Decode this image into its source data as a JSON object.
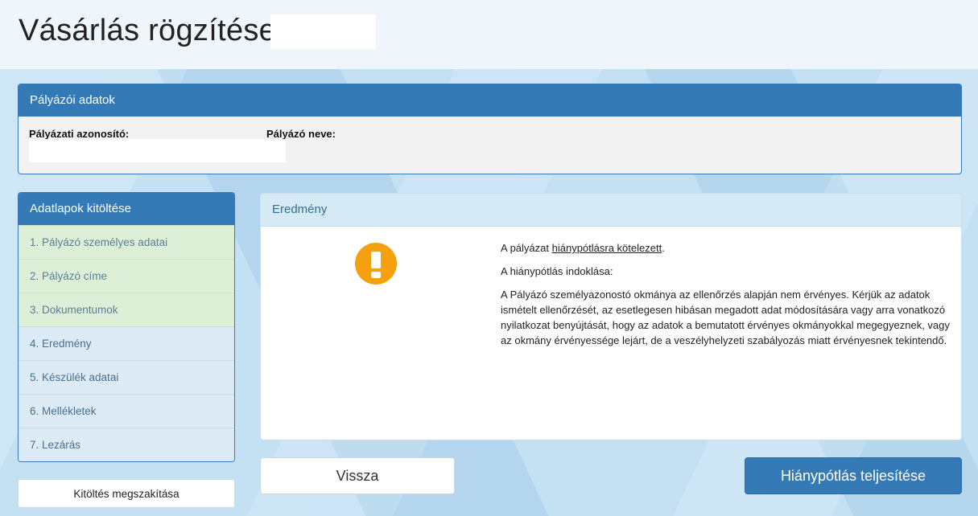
{
  "page": {
    "title": "Vásárlás rögzítése"
  },
  "applicant_panel": {
    "heading": "Pályázói adatok",
    "id_label": "Pályázati azonosító:",
    "name_label": "Pályázó neve:"
  },
  "sidebar": {
    "heading": "Adatlapok kitöltése",
    "steps": [
      {
        "label": "1. Pályázó személyes adatai",
        "status": "done"
      },
      {
        "label": "2. Pályázó címe",
        "status": "done"
      },
      {
        "label": "3. Dokumentumok",
        "status": "done"
      },
      {
        "label": "4. Eredmény",
        "status": "pending"
      },
      {
        "label": "5. Készülék adatai",
        "status": "pending"
      },
      {
        "label": "6. Mellékletek",
        "status": "pending"
      },
      {
        "label": "7. Lezárás",
        "status": "pending"
      }
    ],
    "abort_label": "Kitöltés megszakítása"
  },
  "result": {
    "heading": "Eredmény",
    "line1_prefix": "A pályázat ",
    "line1_link": "hiánypótlásra kötelezett",
    "line1_suffix": ".",
    "reason_label": "A hiánypótlás indoklása:",
    "reason_text": "A Pályázó személyazonostó okmánya az ellenőrzés alapján nem érvényes. Kérjük az adatok ismételt ellenőrzését, az esetlegesen hibásan megadott adat módosítására vagy arra vonatkozó nyilatkozat benyújtását, hogy az adatok a bemutatott érvényes okmányokkal megegyeznek, vagy az okmány érvényessége lejárt, de a veszélyhelyzeti szabályozás miatt érvényesnek tekintendő.",
    "icon": "warning-exclamation-icon",
    "icon_color": "#f5a00f"
  },
  "actions": {
    "back_label": "Vissza",
    "complete_label": "Hiánypótlás teljesítése"
  },
  "colors": {
    "primary": "#337ab7",
    "done_step_bg": "#deefd8",
    "pending_step_bg": "#dcebf5"
  }
}
